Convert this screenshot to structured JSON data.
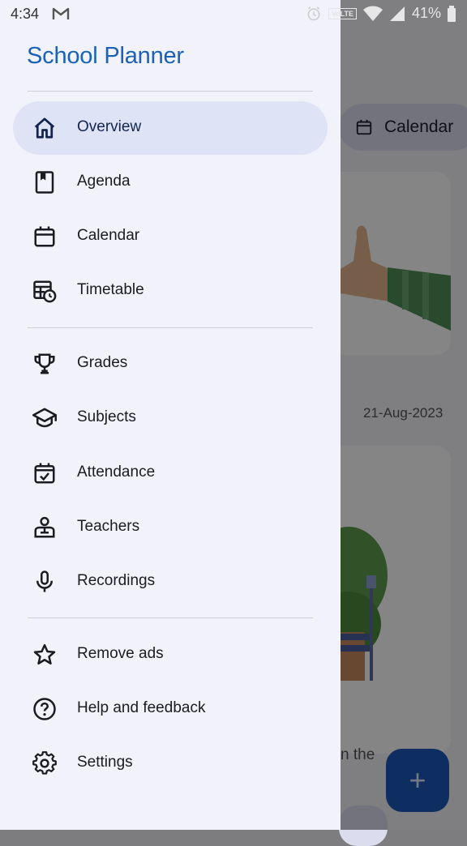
{
  "status_bar": {
    "time": "4:34",
    "volte": "VoLTE",
    "battery": "41%"
  },
  "drawer": {
    "title": "School Planner",
    "items": [
      {
        "label": "Overview",
        "icon": "home-icon",
        "active": true
      },
      {
        "label": "Agenda",
        "icon": "agenda-icon"
      },
      {
        "label": "Calendar",
        "icon": "calendar-icon"
      },
      {
        "label": "Timetable",
        "icon": "timetable-icon"
      },
      {
        "label": "Grades",
        "icon": "trophy-icon"
      },
      {
        "label": "Subjects",
        "icon": "school-icon"
      },
      {
        "label": "Attendance",
        "icon": "attendance-icon"
      },
      {
        "label": "Teachers",
        "icon": "teacher-icon"
      },
      {
        "label": "Recordings",
        "icon": "mic-icon"
      },
      {
        "label": "Remove ads",
        "icon": "star-icon"
      },
      {
        "label": "Help and feedback",
        "icon": "help-icon"
      },
      {
        "label": "Settings",
        "icon": "settings-icon"
      }
    ]
  },
  "background": {
    "calendar_chip": "Calendar",
    "date": "21-Aug-2023",
    "partial_text": "n the",
    "fab": "+"
  },
  "colors": {
    "accent": "#1a62b8",
    "active_bg": "#dfe3f6",
    "drawer_bg": "#f2f2fa",
    "fab": "#1c57b9"
  }
}
